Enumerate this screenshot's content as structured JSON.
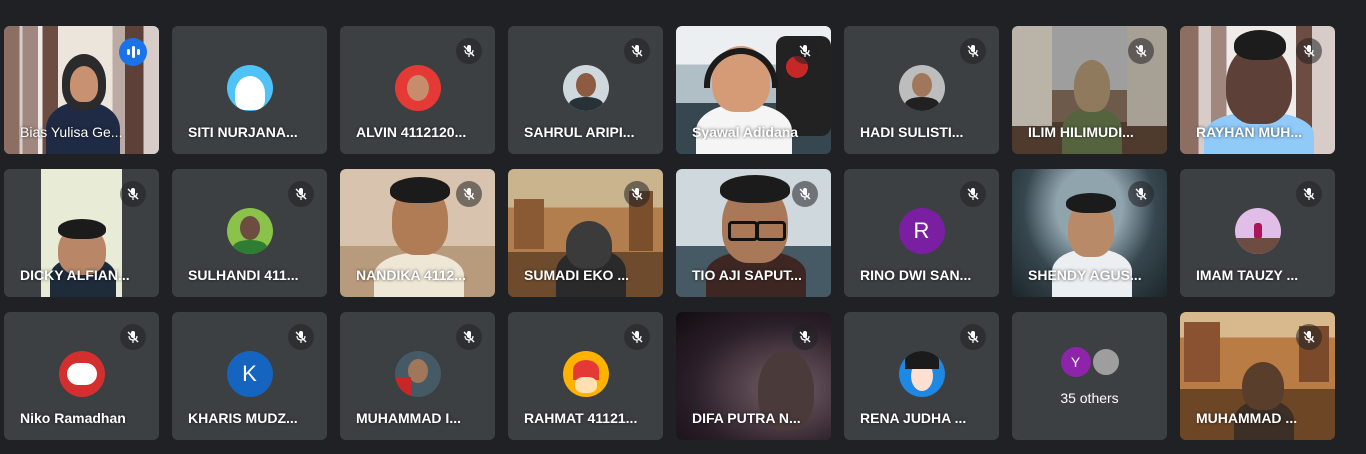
{
  "meeting": {
    "tiles": [
      {
        "name": "Bias Yulisa Ge...",
        "kind": "video",
        "speaking": true
      },
      {
        "name": "SITI NURJANA...",
        "kind": "avatar",
        "avatar_color": "#4fc3f7",
        "avatar_icon": "girl-hijab-avatar"
      },
      {
        "name": "ALVIN 4112120...",
        "kind": "avatar",
        "avatar_color": "#e53935",
        "avatar_icon": "boy-photo-avatar"
      },
      {
        "name": "SAHRUL ARIPI...",
        "kind": "avatar",
        "avatar_color": "#cfd8dc",
        "avatar_icon": "man-photo-avatar"
      },
      {
        "name": "Syawal Adidana",
        "kind": "video"
      },
      {
        "name": "HADI SULISTI...",
        "kind": "avatar",
        "avatar_color": "#bdbdbd",
        "avatar_icon": "man-photo-avatar"
      },
      {
        "name": "ILIM HILIMUDI...",
        "kind": "video"
      },
      {
        "name": "RAYHAN MUH...",
        "kind": "video"
      },
      {
        "name": "DICKY ALFIAN...",
        "kind": "video"
      },
      {
        "name": "SULHANDI 411...",
        "kind": "avatar",
        "avatar_color": "#8bc34a",
        "avatar_icon": "man-photo-avatar"
      },
      {
        "name": "NANDIKA 4112...",
        "kind": "video"
      },
      {
        "name": "SUMADI EKO ...",
        "kind": "video"
      },
      {
        "name": "TIO AJI SAPUT...",
        "kind": "video"
      },
      {
        "name": "RINO DWI SAN...",
        "kind": "avatar",
        "avatar_color": "#7b1fa2",
        "avatar_letter": "R"
      },
      {
        "name": "SHENDY AGUS...",
        "kind": "video"
      },
      {
        "name": "IMAM TAUZY ...",
        "kind": "avatar",
        "avatar_color": "#e1bee7",
        "avatar_icon": "photo-avatar"
      },
      {
        "name": "Niko Ramadhan",
        "kind": "avatar",
        "avatar_color": "#d32f2f",
        "avatar_icon": "cloud-logo-avatar"
      },
      {
        "name": "KHARIS MUDZ...",
        "kind": "avatar",
        "avatar_color": "#1565c0",
        "avatar_letter": "K"
      },
      {
        "name": "MUHAMMAD I...",
        "kind": "avatar",
        "avatar_color": "#455a64",
        "avatar_icon": "man-photo-avatar"
      },
      {
        "name": "RAHMAT 41121...",
        "kind": "avatar",
        "avatar_color": "#ffb300",
        "avatar_icon": "anime-avatar"
      },
      {
        "name": "DIFA PUTRA N...",
        "kind": "video"
      },
      {
        "name": "RENA JUDHA ...",
        "kind": "avatar",
        "avatar_color": "#1e88e5",
        "avatar_icon": "woman-photo-avatar"
      },
      {
        "name": "35 others",
        "kind": "others",
        "avatar_letter": "Y",
        "avatar_color": "#8e24aa"
      },
      {
        "name": "MUHAMMAD ...",
        "kind": "video"
      }
    ]
  }
}
